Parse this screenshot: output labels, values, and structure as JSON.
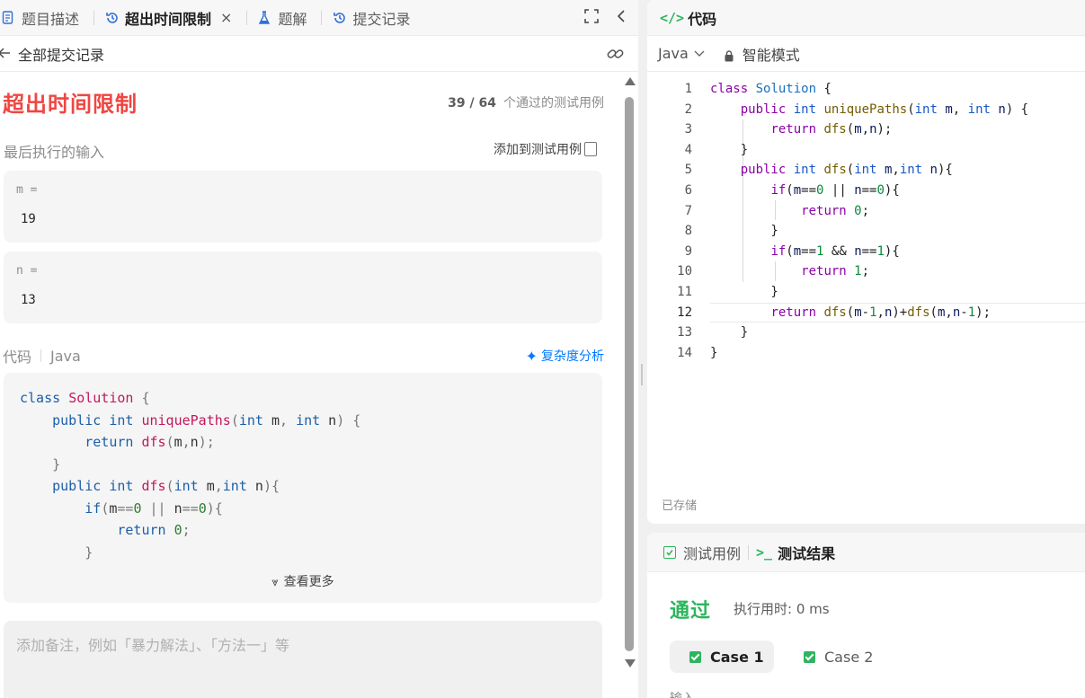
{
  "left_tabs": {
    "description": "题目描述",
    "tle": "超出时间限制",
    "close": "×",
    "solutions": "题解",
    "submissions": "提交记录"
  },
  "submission": {
    "back_label": "全部提交记录",
    "status": "超出时间限制",
    "passed": "39 / 64",
    "passed_suffix": "个通过的测试用例",
    "last_input_label": "最后执行的输入",
    "add_test_label": "添加到测试用例",
    "inputs": [
      {
        "key": "m =",
        "value": "19"
      },
      {
        "key": "n =",
        "value": "13"
      }
    ],
    "code_label": "代码",
    "language": "Java",
    "complexity_label": "复杂度分析",
    "show_more": "查看更多",
    "note_placeholder": "添加备注，例如「暴力解法」、「方法一」等"
  },
  "editor": {
    "title": "代码",
    "language": "Java",
    "mode": "智能模式",
    "saved": "已存储",
    "line_numbers": [
      "1",
      "2",
      "3",
      "4",
      "5",
      "6",
      "7",
      "8",
      "9",
      "10",
      "11",
      "12",
      "13",
      "14"
    ],
    "current_line": 12
  },
  "console": {
    "tab_testcase": "测试用例",
    "tab_result": "测试结果",
    "result": "通过",
    "runtime": "执行用时: 0 ms",
    "cases": [
      "Case 1",
      "Case 2"
    ],
    "input_label": "输入"
  },
  "colors": {
    "error_red": "#ef4743",
    "success_green": "#2db55d",
    "link_blue": "#007aff"
  }
}
